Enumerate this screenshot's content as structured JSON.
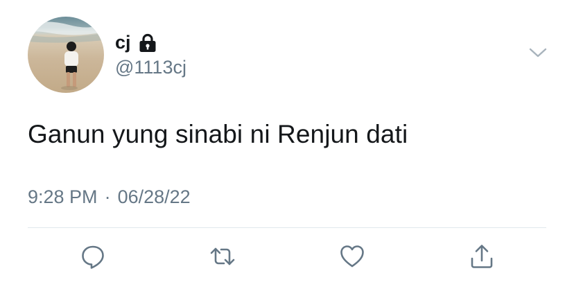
{
  "user": {
    "display_name": "cj",
    "handle": "@1113cj",
    "protected_icon": "lock-icon",
    "avatar": "avatar"
  },
  "tweet": {
    "text": "Ganun yung sinabi ni Renjun dati",
    "time": "9:28 PM",
    "separator": "·",
    "date": "06/28/22"
  },
  "actions": {
    "reply_icon": "reply-icon",
    "retweet_icon": "retweet-icon",
    "like_icon": "heart-icon",
    "share_icon": "share-icon",
    "more_icon": "chevron-down-icon"
  },
  "colors": {
    "text": "#14171a",
    "secondary": "#657786",
    "divider": "#e1e8ed"
  }
}
